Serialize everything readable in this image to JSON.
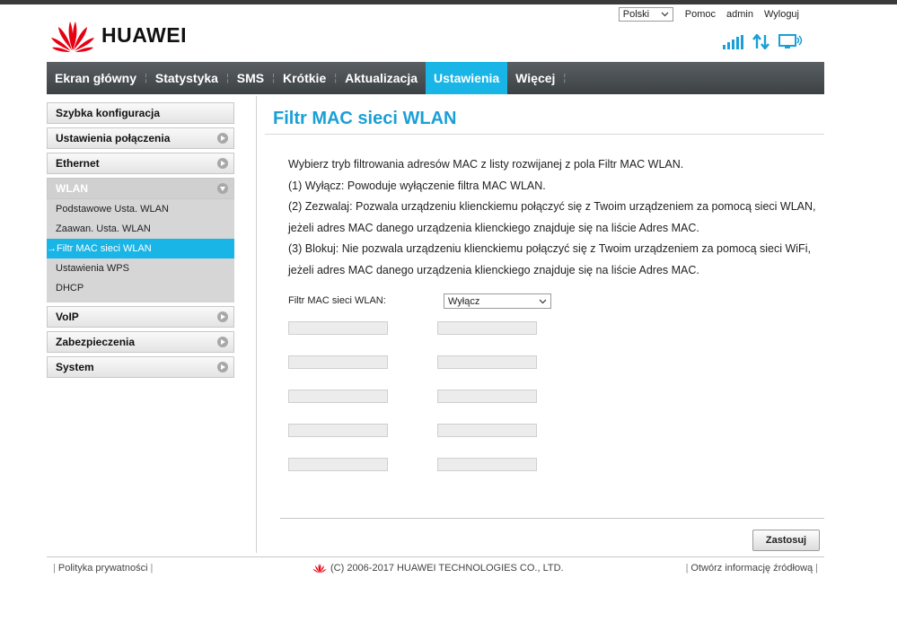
{
  "header": {
    "brand": "HUAWEI",
    "language": "Polski",
    "links": [
      "Pomoc",
      "admin",
      "Wyloguj"
    ]
  },
  "nav": {
    "items": [
      "Ekran główny",
      "Statystyka",
      "SMS",
      "Krótkie",
      "Aktualizacja",
      "Ustawienia",
      "Więcej"
    ],
    "active": "Ustawienia"
  },
  "sidebar": {
    "items": [
      "Szybka konfiguracja",
      "Ustawienia połączenia",
      "Ethernet",
      "WLAN",
      "VoIP",
      "Zabezpieczenia",
      "System"
    ],
    "wlan_sub": [
      "Podstawowe Usta. WLAN",
      "Zaawan. Usta. WLAN",
      "Filtr MAC sieci WLAN",
      "Ustawienia WPS",
      "DHCP"
    ],
    "active_sub": "Filtr MAC sieci WLAN",
    "active_marker": "→"
  },
  "main": {
    "title": "Filtr MAC sieci WLAN",
    "description": [
      "Wybierz tryb filtrowania adresów MAC z listy rozwijanej z pola Filtr MAC WLAN.",
      "(1) Wyłącz: Powoduje wyłączenie filtra MAC WLAN.",
      "(2) Zezwalaj: Pozwala urządzeniu klienckiemu połączyć się z Twoim urządzeniem za pomocą sieci WLAN,",
      "jeżeli adres MAC danego urządzenia klienckiego znajduje się na liście Adres MAC.",
      "(3) Blokuj: Nie pozwala urządzeniu klienckiemu połączyć się z Twoim urządzeniem za pomocą sieci WiFi,",
      "jeżeli adres MAC danego urządzenia klienckiego znajduje się na liście Adres MAC."
    ],
    "filter_label": "Filtr MAC sieci WLAN:",
    "filter_value": "Wyłącz",
    "mac_fields": [
      "",
      "",
      "",
      "",
      "",
      "",
      "",
      "",
      "",
      ""
    ],
    "apply_label": "Zastosuj"
  },
  "footer": {
    "privacy": "Polityka prywatności",
    "copyright": "(C) 2006-2017 HUAWEI TECHNOLOGIES CO., LTD.",
    "open_source": "Otwórz informację źródłową"
  },
  "colors": {
    "accent": "#19b5e6",
    "title": "#1a9fd6",
    "logo_red": "#e60012",
    "nav_dark": "#4a4f52"
  },
  "icons": {
    "signal": "signal-strength-icon",
    "data": "data-transfer-icon",
    "connection": "monitor-connection-icon"
  }
}
